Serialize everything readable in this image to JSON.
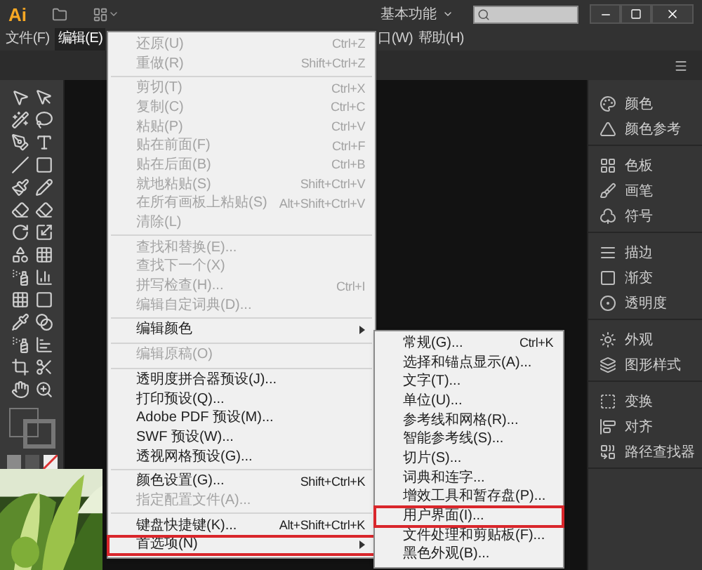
{
  "title_bar": {
    "logo": "Ai",
    "workspace": "基本功能"
  },
  "menu_bar": [
    {
      "label": "文件(F)",
      "selected": false
    },
    {
      "label": "编辑(E)",
      "selected": true
    },
    {
      "label": "口(W)",
      "selected": false
    },
    {
      "label": "帮助(H)",
      "selected": false
    }
  ],
  "edit_menu": [
    {
      "kind": "item",
      "label": "还原(U)",
      "shortcut": "Ctrl+Z",
      "disabled": true,
      "highlighted": false,
      "submenu": false
    },
    {
      "kind": "item",
      "label": "重做(R)",
      "shortcut": "Shift+Ctrl+Z",
      "disabled": true,
      "highlighted": false,
      "submenu": false
    },
    {
      "kind": "separator"
    },
    {
      "kind": "item",
      "label": "剪切(T)",
      "shortcut": "Ctrl+X",
      "disabled": true,
      "highlighted": false,
      "submenu": false
    },
    {
      "kind": "item",
      "label": "复制(C)",
      "shortcut": "Ctrl+C",
      "disabled": true,
      "highlighted": false,
      "submenu": false
    },
    {
      "kind": "item",
      "label": "粘贴(P)",
      "shortcut": "Ctrl+V",
      "disabled": true,
      "highlighted": false,
      "submenu": false
    },
    {
      "kind": "item",
      "label": "贴在前面(F)",
      "shortcut": "Ctrl+F",
      "disabled": true,
      "highlighted": false,
      "submenu": false
    },
    {
      "kind": "item",
      "label": "贴在后面(B)",
      "shortcut": "Ctrl+B",
      "disabled": true,
      "highlighted": false,
      "submenu": false
    },
    {
      "kind": "item",
      "label": "就地粘贴(S)",
      "shortcut": "Shift+Ctrl+V",
      "disabled": true,
      "highlighted": false,
      "submenu": false
    },
    {
      "kind": "item",
      "label": "在所有画板上粘贴(S)",
      "shortcut": "Alt+Shift+Ctrl+V",
      "disabled": true,
      "highlighted": false,
      "submenu": false
    },
    {
      "kind": "item",
      "label": "清除(L)",
      "disabled": true,
      "highlighted": false,
      "submenu": false
    },
    {
      "kind": "separator"
    },
    {
      "kind": "item",
      "label": "查找和替换(E)...",
      "disabled": true,
      "highlighted": false,
      "submenu": false
    },
    {
      "kind": "item",
      "label": "查找下一个(X)",
      "disabled": true,
      "highlighted": false,
      "submenu": false
    },
    {
      "kind": "item",
      "label": "拼写检查(H)...",
      "shortcut": "Ctrl+I",
      "disabled": true,
      "highlighted": false,
      "submenu": false
    },
    {
      "kind": "item",
      "label": "编辑自定词典(D)...",
      "disabled": true,
      "highlighted": false,
      "submenu": false
    },
    {
      "kind": "separator"
    },
    {
      "kind": "item",
      "label": "编辑颜色",
      "disabled": false,
      "highlighted": false,
      "submenu": true
    },
    {
      "kind": "separator"
    },
    {
      "kind": "item",
      "label": "编辑原稿(O)",
      "disabled": true,
      "highlighted": false,
      "submenu": false
    },
    {
      "kind": "separator"
    },
    {
      "kind": "item",
      "label": "透明度拼合器预设(J)...",
      "disabled": false,
      "highlighted": false,
      "submenu": false
    },
    {
      "kind": "item",
      "label": "打印预设(Q)...",
      "disabled": false,
      "highlighted": false,
      "submenu": false
    },
    {
      "kind": "item",
      "label": "Adobe PDF 预设(M)...",
      "disabled": false,
      "highlighted": false,
      "submenu": false
    },
    {
      "kind": "item",
      "label": "SWF 预设(W)...",
      "disabled": false,
      "highlighted": false,
      "submenu": false
    },
    {
      "kind": "item",
      "label": "透视网格预设(G)...",
      "disabled": false,
      "highlighted": false,
      "submenu": false
    },
    {
      "kind": "separator"
    },
    {
      "kind": "item",
      "label": "颜色设置(G)...",
      "shortcut": "Shift+Ctrl+K",
      "disabled": false,
      "highlighted": false,
      "submenu": false
    },
    {
      "kind": "item",
      "label": "指定配置文件(A)...",
      "disabled": true,
      "highlighted": false,
      "submenu": false
    },
    {
      "kind": "separator"
    },
    {
      "kind": "item",
      "label": "键盘快捷键(K)...",
      "shortcut": "Alt+Shift+Ctrl+K",
      "disabled": false,
      "highlighted": false,
      "submenu": false
    },
    {
      "kind": "item",
      "label": "首选项(N)",
      "disabled": false,
      "highlighted": true,
      "submenu": true
    }
  ],
  "preferences_submenu": [
    {
      "label": "常规(G)...",
      "shortcut": "Ctrl+K",
      "highlighted": false
    },
    {
      "label": "选择和锚点显示(A)...",
      "highlighted": false
    },
    {
      "label": "文字(T)...",
      "highlighted": false
    },
    {
      "label": "单位(U)...",
      "highlighted": false
    },
    {
      "label": "参考线和网格(R)...",
      "highlighted": false
    },
    {
      "label": "智能参考线(S)...",
      "highlighted": false
    },
    {
      "label": "切片(S)...",
      "highlighted": false
    },
    {
      "label": "词典和连字...",
      "highlighted": false
    },
    {
      "label": "增效工具和暂存盘(P)...",
      "highlighted": false
    },
    {
      "label": "用户界面(I)...",
      "highlighted": true
    },
    {
      "label": "文件处理和剪贴板(F)...",
      "highlighted": false
    },
    {
      "label": "黑色外观(B)...",
      "highlighted": false
    }
  ],
  "panels": [
    {
      "items": [
        {
          "label": "颜色"
        },
        {
          "label": "颜色参考"
        }
      ]
    },
    {
      "items": [
        {
          "label": "色板"
        },
        {
          "label": "画笔"
        },
        {
          "label": "符号"
        }
      ]
    },
    {
      "items": [
        {
          "label": "描边"
        },
        {
          "label": "渐变"
        },
        {
          "label": "透明度"
        }
      ]
    },
    {
      "items": [
        {
          "label": "外观"
        },
        {
          "label": "图形样式"
        }
      ]
    },
    {
      "items": [
        {
          "label": "变换"
        },
        {
          "label": "对齐"
        },
        {
          "label": "路径查找器"
        }
      ]
    }
  ]
}
